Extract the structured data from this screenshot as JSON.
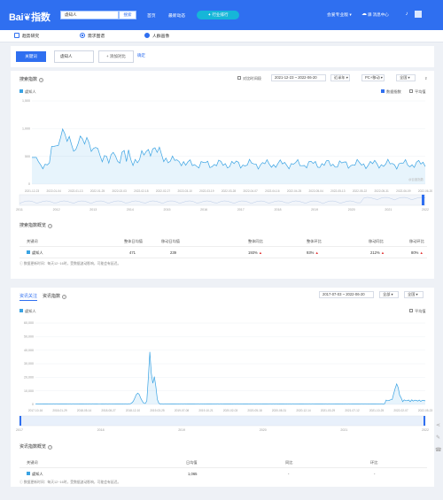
{
  "header": {
    "logo": "Bai",
    "logo_suffix": "指数",
    "search_value": "虐知人",
    "search_button": "搜索",
    "nav": [
      "首页",
      "最新动态"
    ],
    "nav_pill": "行业排行",
    "user_menu": "会爱专业版",
    "message": "驿 消息中心"
  },
  "tabs": [
    {
      "label": "趋势研究",
      "icon": "trend-icon"
    },
    {
      "label": "需求图谱",
      "icon": "radio-icon"
    },
    {
      "label": "人群画像",
      "icon": "person-icon"
    }
  ],
  "keyword_bar": {
    "button": "关键词",
    "keyword": "虐知人",
    "compare": "+ 添加对比",
    "confirm": "确定"
  },
  "search_index": {
    "title": "搜索指数",
    "legend": "虐知人",
    "date_compare": "对比时间段",
    "date_range": "2021-12-23 ~ 2022-06-20",
    "range_select": "近半年",
    "device": "PC+移动",
    "region": "全国",
    "opt_data": "数据指数",
    "opt_avg": "平均值",
    "y_ticks": [
      "1,500",
      "1,000",
      "500",
      "0"
    ],
    "x_labels": [
      "2021-12-23",
      "2022-01-04",
      "2022-01-13",
      "2022-01-25",
      "2022-02-03",
      "2022-02-18",
      "2022-02-27",
      "2022-03-10",
      "2022-03-19",
      "2022-03-28",
      "2022-04-07",
      "2022-04-16",
      "2022-04-25",
      "2022-05-04",
      "2022-05-13",
      "2022-05-22",
      "2022-05-31",
      "2022-06-09",
      "2022-06-20"
    ],
    "timeline_years": [
      "2011",
      "2012",
      "2013",
      "2014",
      "2015",
      "2016",
      "2017",
      "2018",
      "2019",
      "2020",
      "2021",
      "2022"
    ],
    "watermark": "@百度指数",
    "color": "#3aa3e3"
  },
  "search_overview": {
    "title": "搜索指数概览",
    "headers": [
      "关键词",
      "整体日均值",
      "移动日均值",
      "整体同比",
      "整体环比",
      "移动同比",
      "移动环比"
    ],
    "rows": [
      {
        "keyword": "虐知人",
        "overall_avg": "471",
        "mobile_avg": "239",
        "yoy": "193%",
        "mom": "93%",
        "mobile_yoy": "212%",
        "mobile_mom": "80%"
      }
    ],
    "note": "数据更新时间：每天12~16时，受数据波动影响，可能会有延迟。"
  },
  "news_index": {
    "tab_active": "资讯关注",
    "tab_other": "资讯指数",
    "legend": "虐知人",
    "date_range": "2017-07-03 ~ 2022-06-20",
    "range_select": "全部",
    "region": "全国",
    "opt_avg": "平均值",
    "y_ticks": [
      "60,000",
      "50,000",
      "40,000",
      "30,000",
      "20,000",
      "10,000",
      "0"
    ],
    "x_labels": [
      "2017-10-16",
      "2018-01-29",
      "2018-05-14",
      "2018-08-27",
      "2018-12-10",
      "2019-03-25",
      "2019-07-08",
      "2019-10-21",
      "2020-02-03",
      "2020-05-18",
      "2020-08-31",
      "2020-12-14",
      "2021-03-29",
      "2021-07-12",
      "2021-10-25",
      "2022-02-07",
      "2022-05-23"
    ],
    "timeline_years": [
      "2017",
      "2018",
      "2019",
      "2020",
      "2021",
      "2022"
    ],
    "color": "#3aa3e3"
  },
  "news_overview": {
    "title": "资讯指数概览",
    "headers": [
      "关键词",
      "日均值",
      "同比",
      "环比"
    ],
    "rows": [
      {
        "keyword": "虐知人",
        "avg": "1,065",
        "yoy": "-",
        "mom": "-"
      }
    ],
    "note": "数据更新时间：每天12~16时，受数据波动影响，可能会有延迟。"
  }
}
